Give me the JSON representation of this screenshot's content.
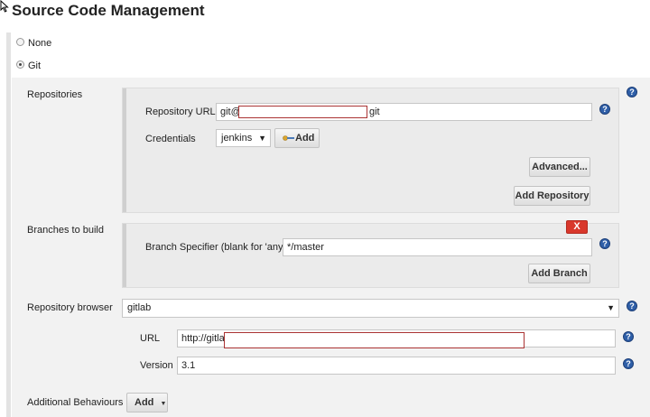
{
  "page": {
    "title": "Source Code Management"
  },
  "scm_options": [
    {
      "label": "None",
      "selected": false
    },
    {
      "label": "Git",
      "selected": true
    }
  ],
  "repositories": {
    "label": "Repositories",
    "url_label": "Repository URL",
    "url_prefix": "git@",
    "url_suffix": "git",
    "credentials_label": "Credentials",
    "credentials_value": "jenkins",
    "add_label": "Add",
    "advanced_label": "Advanced...",
    "add_repository_label": "Add Repository"
  },
  "branches": {
    "label": "Branches to build",
    "delete_label": "X",
    "specifier_label": "Branch Specifier (blank for 'any')",
    "specifier_value": "*/master",
    "add_branch_label": "Add Branch"
  },
  "repo_browser": {
    "label": "Repository browser",
    "value": "gitlab",
    "url_label": "URL",
    "url_value": "http://gitlab",
    "version_label": "Version",
    "version_value": "3.1"
  },
  "additional": {
    "label": "Additional Behaviours",
    "add_label": "Add"
  },
  "icons": {
    "help": "help-icon",
    "key": "key-icon",
    "caret": "chevron-down-icon"
  },
  "colors": {
    "help_blue": "#2f5fa8",
    "delete_red": "#d9382c",
    "redaction_border": "#aa3333"
  }
}
